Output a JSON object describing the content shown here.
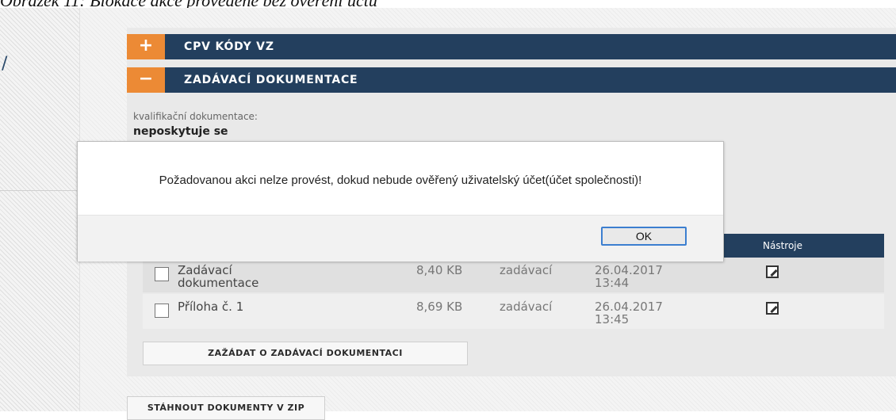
{
  "caption": "Obrázek 11: Blokace akce provedené bez ověření účtu",
  "left_mark": "/",
  "sections": [
    {
      "toggle": "+",
      "label": "CPV KÓDY VZ"
    },
    {
      "toggle": "−",
      "label": "ZADÁVACÍ DOKUMENTACE"
    }
  ],
  "qualification": {
    "label": "kvalifikační dokumentace:",
    "value": "neposkytuje se"
  },
  "table": {
    "header_tools": "Nástroje",
    "rows": [
      {
        "name": "Zadávací dokumentace",
        "size": "8,40 KB",
        "who": "zadávací",
        "date": "26.04.2017 13:44"
      },
      {
        "name": "Příloha č. 1",
        "size": "8,69 KB",
        "who": "zadávací",
        "date": "26.04.2017 13:45"
      }
    ]
  },
  "buttons": {
    "request": "ZAŽÁDAT O ZADÁVACÍ DOKUMENTACI",
    "zip": "STÁHNOUT DOKUMENTY V ZIP"
  },
  "dialog": {
    "message": "Požadovanou akci nelze provést, dokud nebude ověřený uživatelský účet(účet společnosti)!",
    "ok": "OK"
  },
  "icons": {
    "edit": "edit-icon"
  },
  "colors": {
    "navy": "#233f5e",
    "accent": "#ec8a35",
    "focus": "#3c7fd0"
  }
}
